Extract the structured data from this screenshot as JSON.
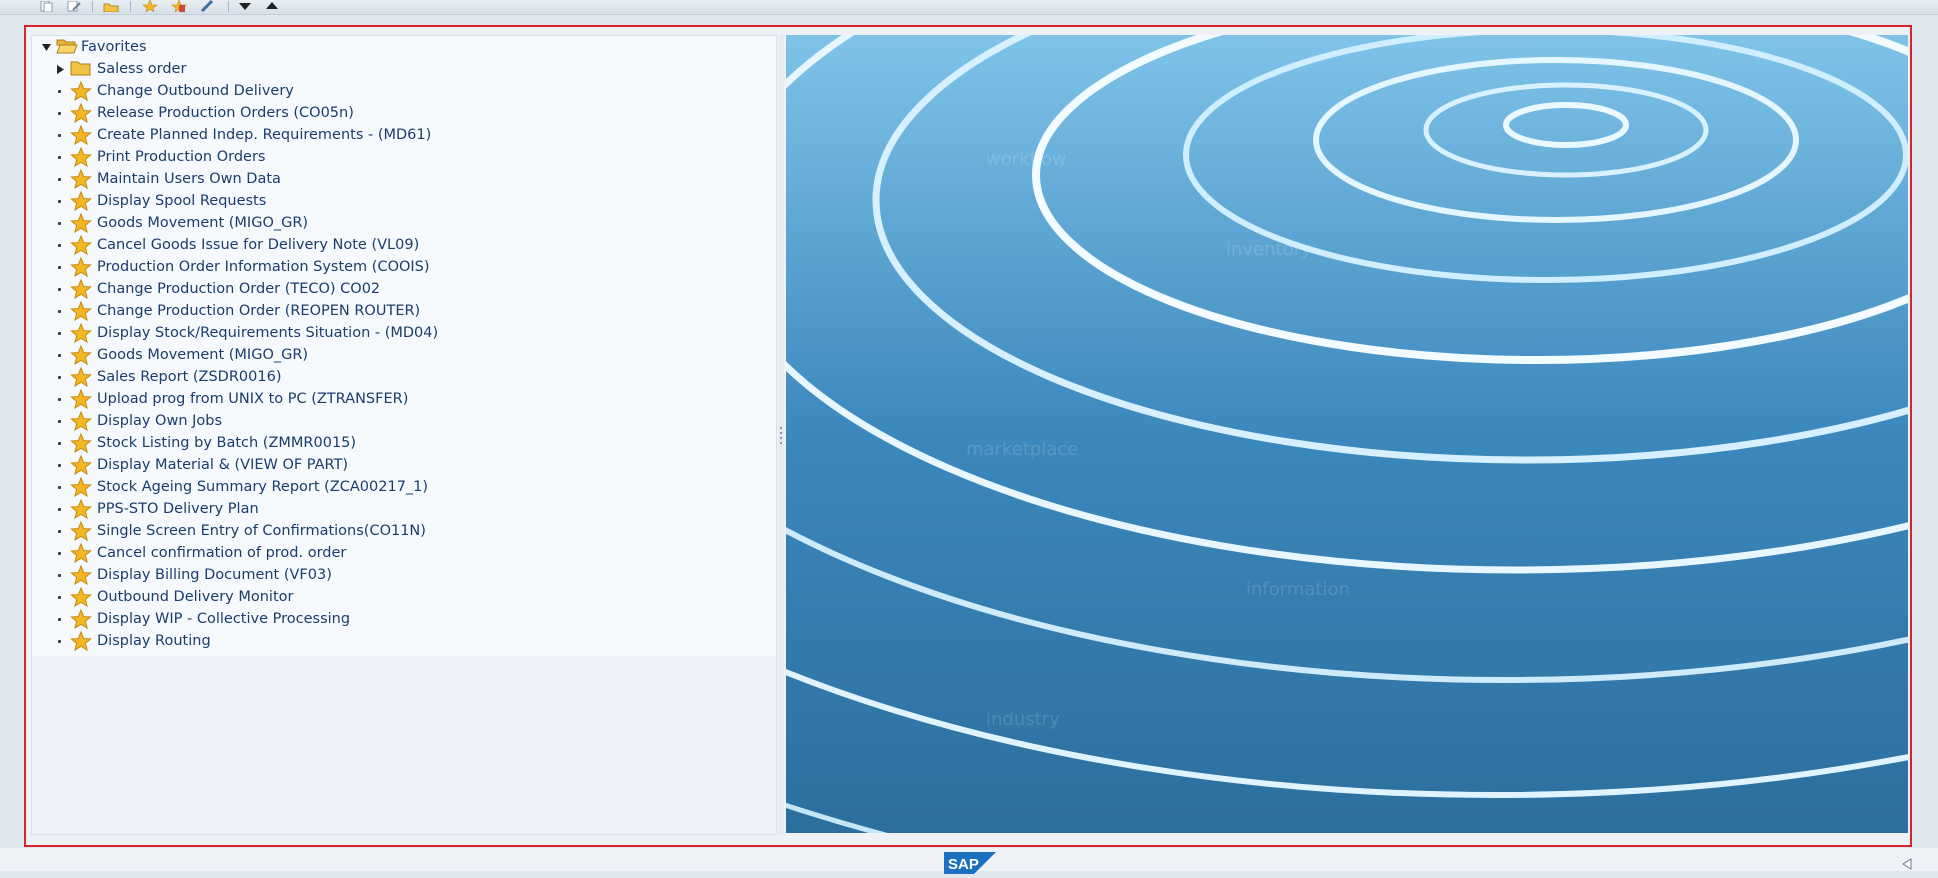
{
  "toolbar": {
    "icons": [
      "copy-icon",
      "edit-icon",
      "folder-icon",
      "add-favorite-icon",
      "delete-favorite-icon",
      "pencil-icon",
      "move-down-icon",
      "move-up-icon"
    ]
  },
  "tree": {
    "root_label": "Favorites",
    "items": [
      {
        "label": "Saless order",
        "type": "folder"
      },
      {
        "label": "Change Outbound Delivery",
        "type": "favorite"
      },
      {
        "label": "Release Production Orders (CO05n)",
        "type": "favorite"
      },
      {
        "label": "Create Planned Indep. Requirements - (MD61)",
        "type": "favorite"
      },
      {
        "label": "Print Production Orders",
        "type": "favorite"
      },
      {
        "label": "Maintain Users Own Data",
        "type": "favorite"
      },
      {
        "label": "Display Spool Requests",
        "type": "favorite"
      },
      {
        "label": "Goods Movement (MIGO_GR)",
        "type": "favorite"
      },
      {
        "label": "Cancel Goods Issue for Delivery Note (VL09)",
        "type": "favorite"
      },
      {
        "label": "Production Order Information System (COOIS)",
        "type": "favorite"
      },
      {
        "label": "Change Production Order (TECO) CO02",
        "type": "favorite"
      },
      {
        "label": "Change Production Order (REOPEN ROUTER)",
        "type": "favorite"
      },
      {
        "label": "Display Stock/Requirements Situation - (MD04)",
        "type": "favorite"
      },
      {
        "label": "Goods Movement (MIGO_GR)",
        "type": "favorite"
      },
      {
        "label": "Sales Report (ZSDR0016)",
        "type": "favorite"
      },
      {
        "label": "Upload prog from UNIX to PC (ZTRANSFER)",
        "type": "favorite"
      },
      {
        "label": "Display Own Jobs",
        "type": "favorite"
      },
      {
        "label": "Stock Listing by Batch (ZMMR0015)",
        "type": "favorite"
      },
      {
        "label": "Display Material & (VIEW OF PART)",
        "type": "favorite"
      },
      {
        "label": "Stock Ageing Summary Report (ZCA00217_1)",
        "type": "favorite"
      },
      {
        "label": "PPS-STO Delivery Plan",
        "type": "favorite"
      },
      {
        "label": "Single Screen Entry of Confirmations(CO11N)",
        "type": "favorite"
      },
      {
        "label": "Cancel confirmation of prod. order",
        "type": "favorite"
      },
      {
        "label": "Display Billing Document (VF03)",
        "type": "favorite"
      },
      {
        "label": "Outbound Delivery Monitor",
        "type": "favorite"
      },
      {
        "label": "Display WIP - Collective Processing",
        "type": "favorite"
      },
      {
        "label": "Display Routing",
        "type": "favorite"
      }
    ]
  },
  "footer": {
    "logo_text": "SAP"
  },
  "colors": {
    "frame_border": "#d5252b",
    "link_text": "#1a3d6b",
    "star": "#f5b623",
    "folder": "#f3c443"
  }
}
